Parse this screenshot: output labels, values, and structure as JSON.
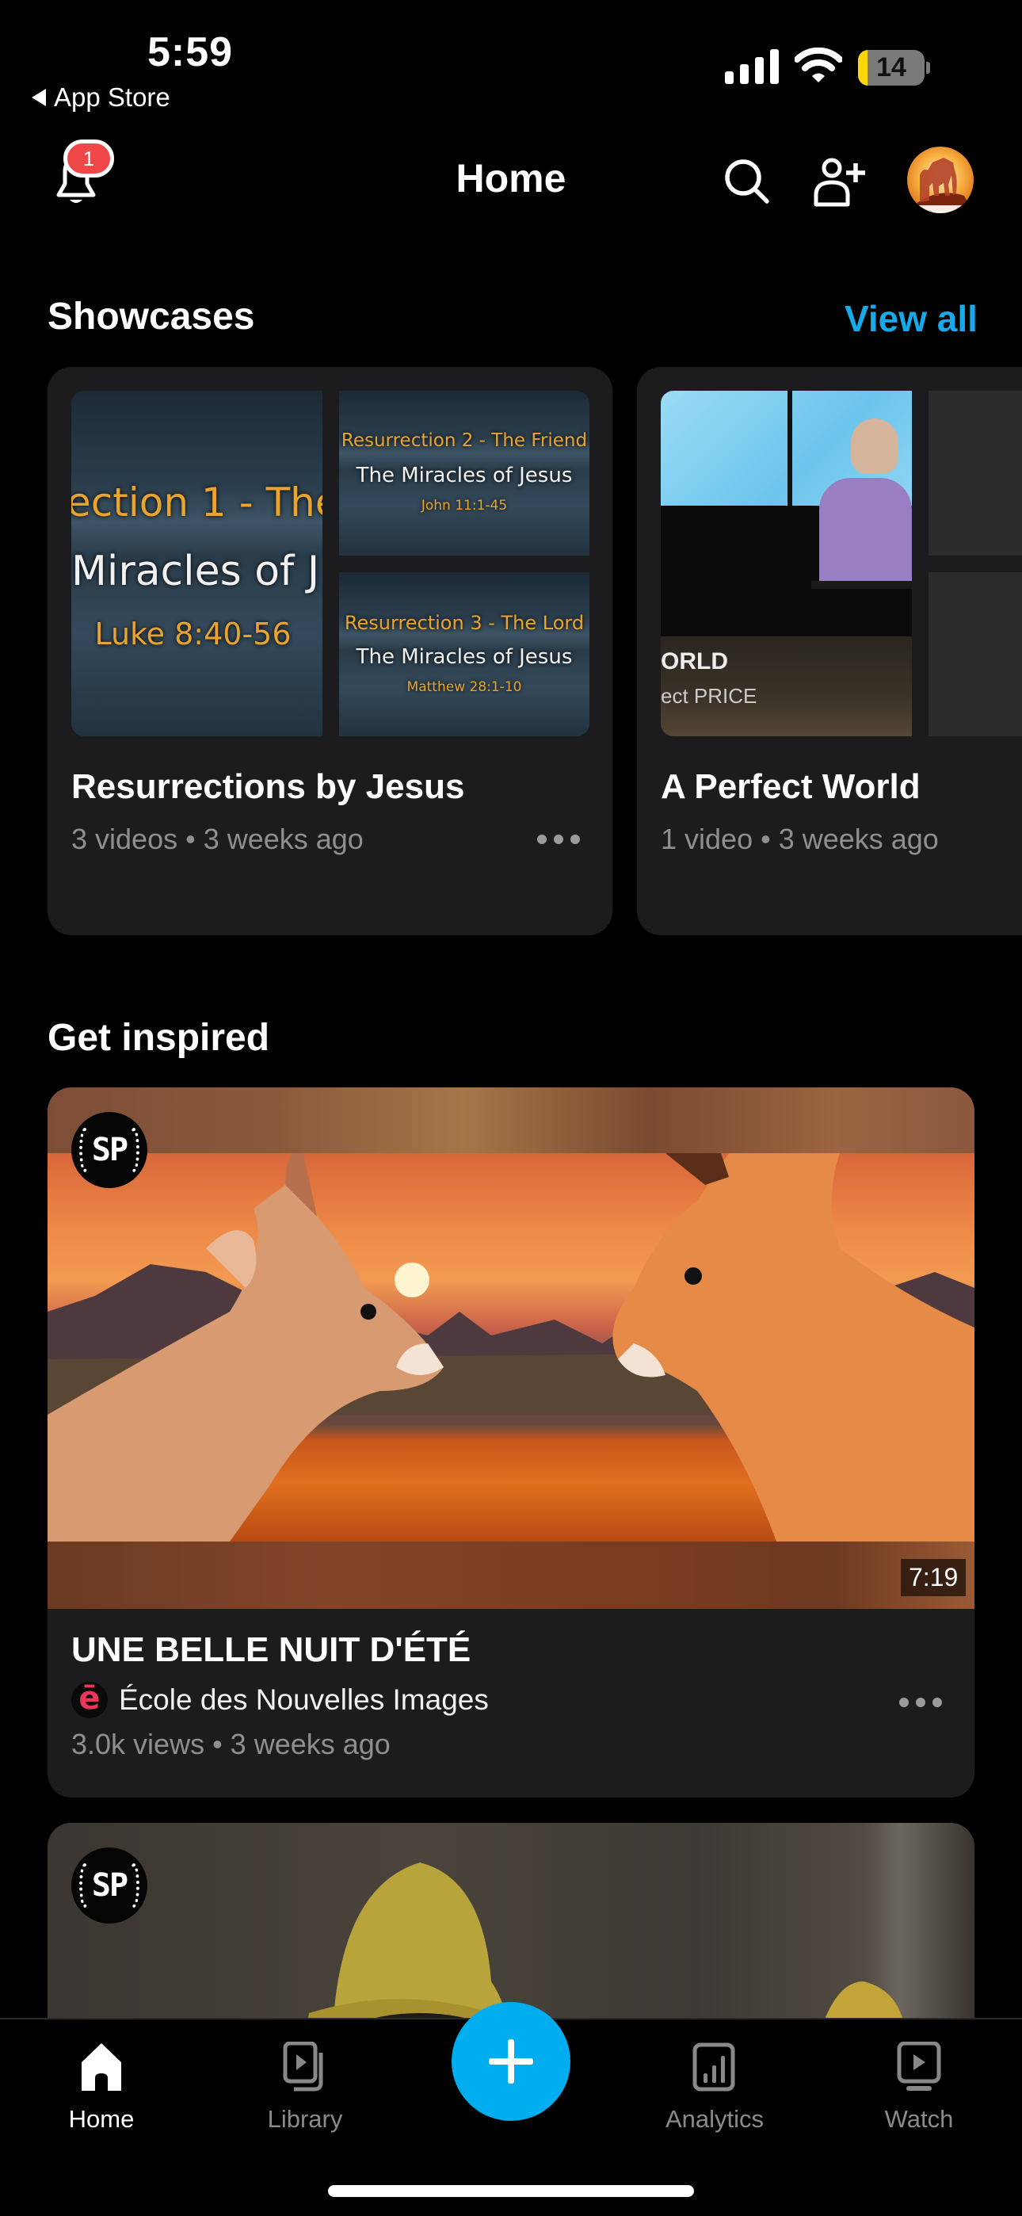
{
  "status_bar": {
    "time": "5:59",
    "back_app": "App Store",
    "battery_level": "14",
    "battery_fraction": 0.14,
    "icons": [
      "signal-icon",
      "wifi-icon",
      "battery-icon"
    ]
  },
  "header": {
    "title": "Home",
    "notification_count": "1",
    "icons": [
      "bell-icon",
      "search-icon",
      "add-user-icon",
      "avatar"
    ]
  },
  "showcases": {
    "title": "Showcases",
    "view_all_label": "View all",
    "accent_color": "#17a9e8",
    "items": [
      {
        "name": "Resurrections by Jesus",
        "meta": "3 videos • 3 weeks ago",
        "thumbnails": [
          {
            "heading": "ection 1 - The",
            "subtitle": "Miracles of J",
            "reference": "Luke 8:40-56"
          },
          {
            "heading": "Resurrection 2 - The Friend",
            "subtitle": "The Miracles of Jesus",
            "reference": "John 11:1-45"
          },
          {
            "heading": "Resurrection 3 - The Lord",
            "subtitle": "The Miracles of Jesus",
            "reference": "Matthew 28:1-10"
          }
        ]
      },
      {
        "name": "A Perfect World",
        "meta": "1 video • 3 weeks ago",
        "thumbnails": [
          {
            "line1": "ORLD",
            "line2": "ect PRICE"
          }
        ]
      }
    ]
  },
  "get_inspired": {
    "title": "Get inspired",
    "videos": [
      {
        "badge": "SP",
        "duration": "7:19",
        "title": "UNE BELLE NUIT D'ÉTÉ",
        "channel_logo": "ē",
        "channel": "École des Nouvelles Images",
        "meta": "3.0k views • 3 weeks ago"
      },
      {
        "badge": "SP"
      }
    ]
  },
  "tab_bar": {
    "items": [
      {
        "label": "Home",
        "icon": "home-icon",
        "active": true
      },
      {
        "label": "Library",
        "icon": "library-icon",
        "active": false
      },
      {
        "label": "",
        "icon": "plus-icon",
        "active": false
      },
      {
        "label": "Analytics",
        "icon": "analytics-icon",
        "active": false
      },
      {
        "label": "Watch",
        "icon": "watch-icon",
        "active": false
      }
    ],
    "fab_color": "#00aef0"
  }
}
